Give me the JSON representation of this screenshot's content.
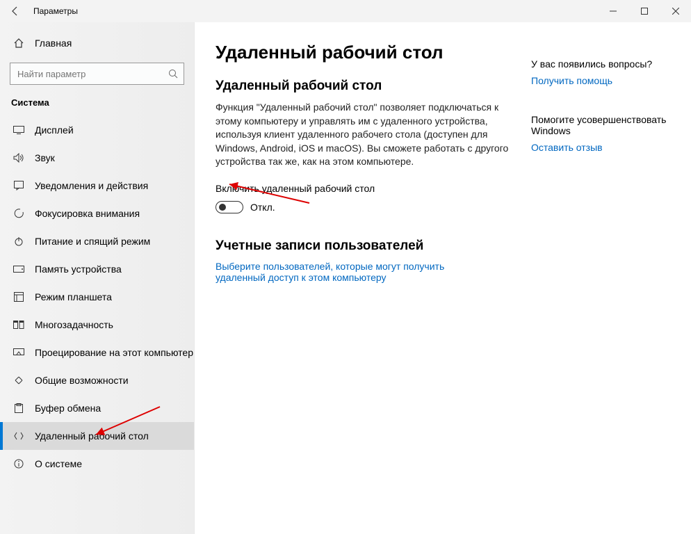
{
  "titlebar": {
    "label": "Параметры"
  },
  "home": {
    "label": "Главная"
  },
  "search": {
    "placeholder": "Найти параметр"
  },
  "category": "Система",
  "nav": {
    "items": [
      {
        "label": "Дисплей"
      },
      {
        "label": "Звук"
      },
      {
        "label": "Уведомления и действия"
      },
      {
        "label": "Фокусировка внимания"
      },
      {
        "label": "Питание и спящий режим"
      },
      {
        "label": "Память устройства"
      },
      {
        "label": "Режим планшета"
      },
      {
        "label": "Многозадачность"
      },
      {
        "label": "Проецирование на этот компьютер"
      },
      {
        "label": "Общие возможности"
      },
      {
        "label": "Буфер обмена"
      },
      {
        "label": "Удаленный рабочий стол"
      },
      {
        "label": "О системе"
      }
    ]
  },
  "page": {
    "title": "Удаленный рабочий стол",
    "section1_heading": "Удаленный рабочий стол",
    "description": "Функция \"Удаленный рабочий стол\" позволяет подключаться к этому компьютеру и управлять им с удаленного устройства, используя клиент удаленного рабочего стола (доступен для Windows, Android, iOS и macOS). Вы сможете работать с другого устройства так же, как на этом компьютере.",
    "enable_label": "Включить удаленный рабочий стол",
    "toggle_state": "Откл.",
    "section2_heading": "Учетные записи пользователей",
    "select_users_link": "Выберите пользователей, которые могут получить удаленный доступ к этом компьютеру"
  },
  "aside": {
    "question": "У вас появились вопросы?",
    "help_link": "Получить помощь",
    "improve_text": "Помогите усовершенствовать Windows",
    "feedback_link": "Оставить отзыв"
  }
}
